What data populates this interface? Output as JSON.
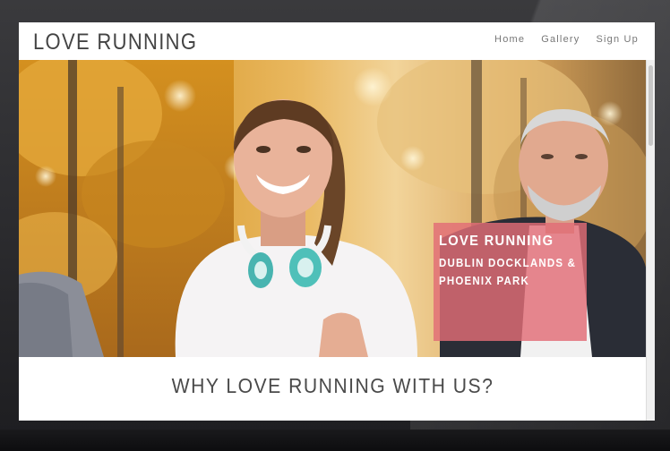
{
  "site": {
    "logo": "LOVE RUNNING"
  },
  "nav": {
    "items": [
      {
        "label": "Home"
      },
      {
        "label": "Gallery"
      },
      {
        "label": "Sign Up"
      }
    ]
  },
  "hero": {
    "card_title": "LOVE RUNNING",
    "card_subtitle_line1": "DUBLIN DOCKLANDS &",
    "card_subtitle_line2": "PHOENIX PARK",
    "card_color": "#e26c76"
  },
  "section": {
    "title": "WHY LOVE RUNNING WITH US?"
  }
}
